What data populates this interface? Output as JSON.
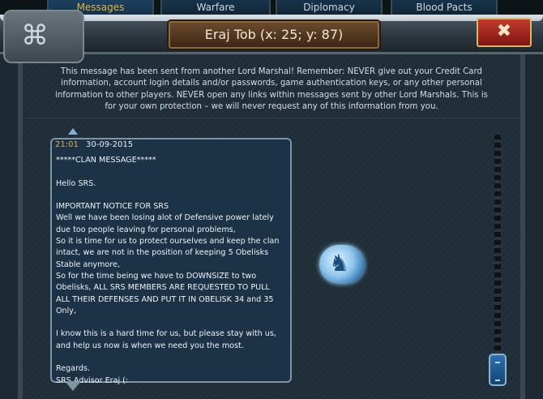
{
  "tabs": [
    {
      "label": "Messages",
      "active": true
    },
    {
      "label": "Warfare",
      "active": false
    },
    {
      "label": "Diplomacy",
      "active": false
    },
    {
      "label": "Blood Pacts",
      "active": false
    }
  ],
  "header": {
    "title": "Eraj Tob (x: 25; y: 87)",
    "close_label": "✖"
  },
  "notice": "This message has been sent from another Lord Marshal! Remember: NEVER give out your Credit Card information, account login details and/or passwords, game authentication keys, or any other personal information to other players. NEVER open any links within messages sent by other Lord Marshals. This is for your own protection – we will never request any of this information from you.",
  "message": {
    "time": "21:01",
    "date": "30-09-2015",
    "body": "*****CLAN MESSAGE*****\n\nHello SRS.\n\nIMPORTANT NOTICE FOR SRS\nWell we have been losing alot of Defensive power lately due too people leaving for personal problems,\nSo it is time for us to protect ourselves and keep the clan intact, we are not in the position of keeping 5 Obelisks Stable anymore,\nSo for the time being we have to DOWNSIZE to two Obelisks, ALL SRS MEMBERS ARE REQUESTED TO PULL ALL THEIR DEFENSES AND PUT IT IN OBELISK 34 and 35 Only,\n\nI know this is a hard time for us, but please stay with us, and help us now is when we need you the most.\n\nRegards.\nSRS Advisor Eraj (:"
  },
  "icons": {
    "emblem": "dragon-emblem-icon",
    "close": "close-icon",
    "knot": "celtic-knot-icon"
  },
  "colors": {
    "accent_gold": "#e0b642",
    "close_red": "#c23a2c",
    "message_bg": "#1c3247"
  }
}
